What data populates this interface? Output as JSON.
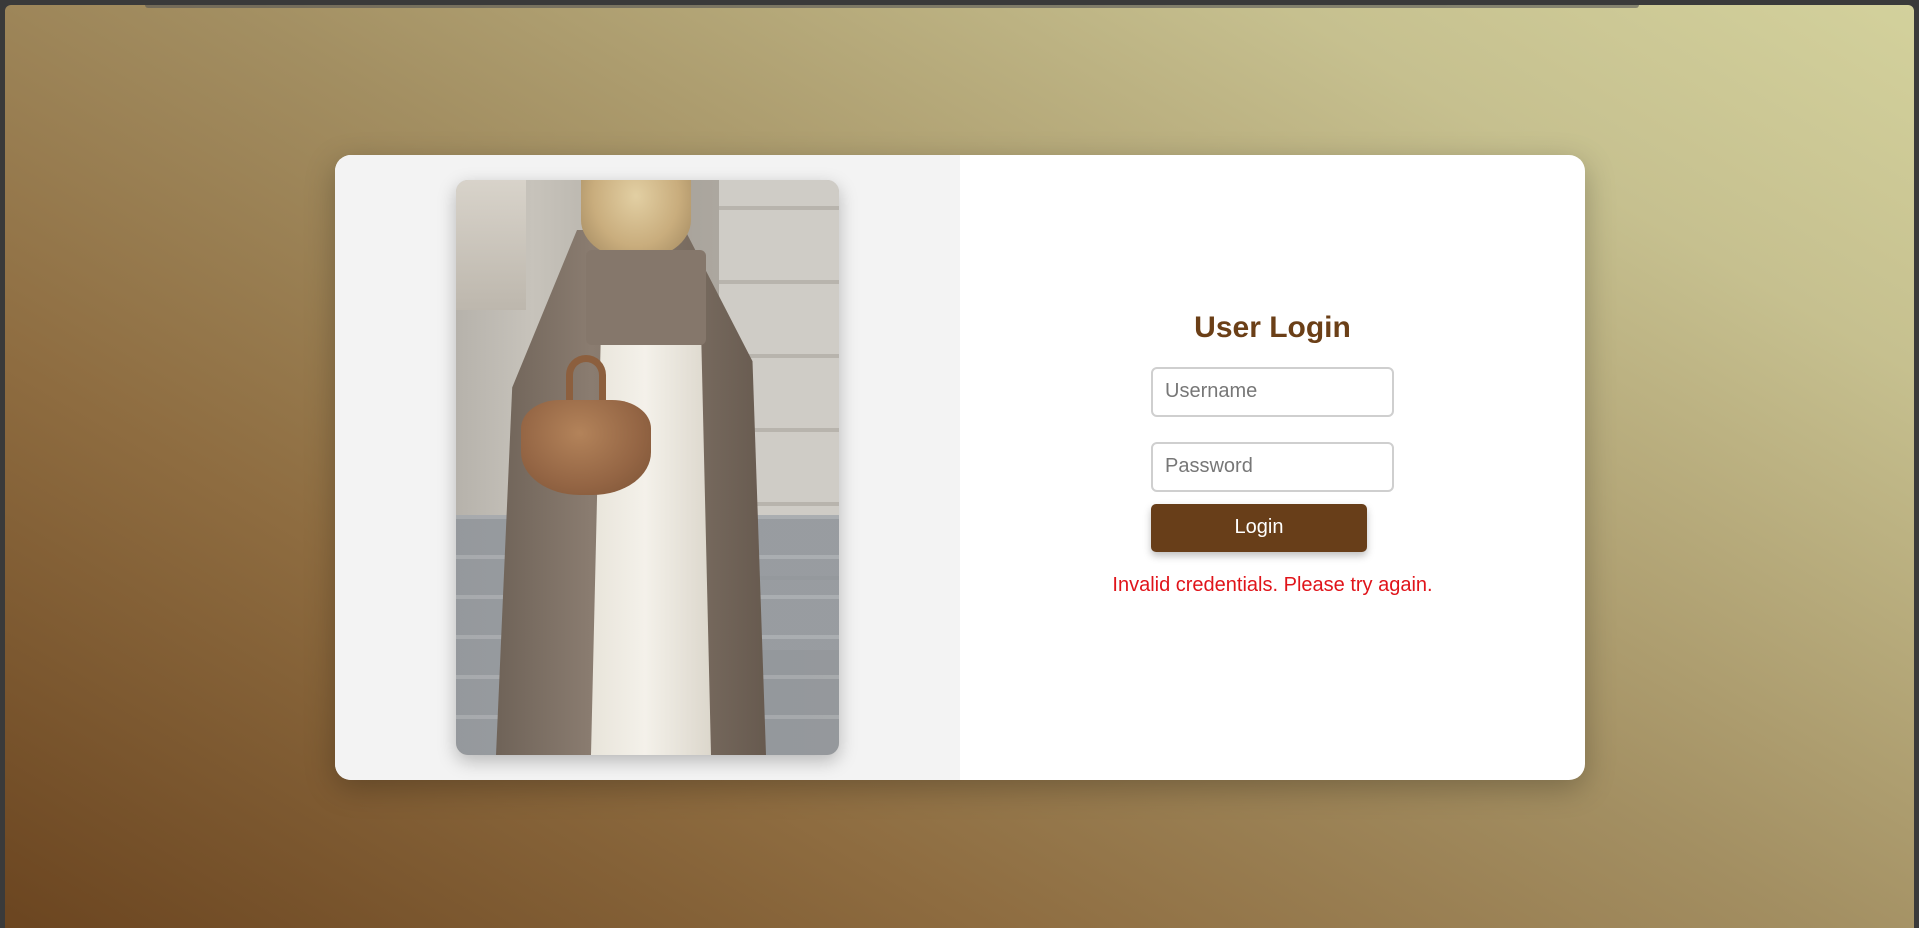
{
  "login": {
    "title": "User Login",
    "username_placeholder": "Username",
    "password_placeholder": "Password",
    "button_label": "Login",
    "error_message": "Invalid credentials. Please try again."
  },
  "theme": {
    "accent": "#683e19",
    "title_color": "#6b3f17",
    "error_color": "#e0141a"
  },
  "image": {
    "description_icon": "fashion-photo"
  }
}
